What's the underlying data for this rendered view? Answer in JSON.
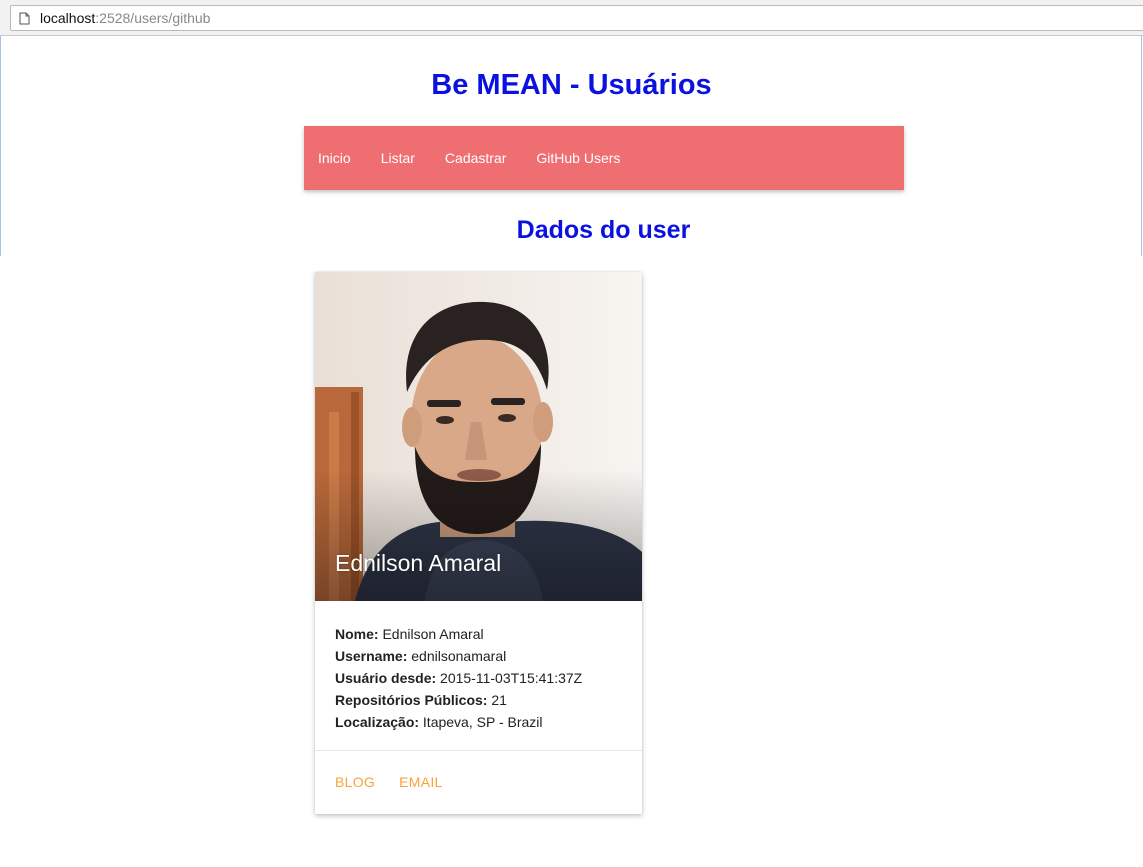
{
  "browser": {
    "url_host": "localhost",
    "url_rest": ":2528/users/github"
  },
  "header": {
    "title": "Be MEAN - Usuários"
  },
  "nav": {
    "items": [
      {
        "label": "Inicio"
      },
      {
        "label": "Listar"
      },
      {
        "label": "Cadastrar"
      },
      {
        "label": "GitHub Users"
      }
    ]
  },
  "section": {
    "title": "Dados do user"
  },
  "card": {
    "name": "Ednilson Amaral",
    "fields": [
      {
        "label": "Nome:",
        "value": "Ednilson Amaral"
      },
      {
        "label": "Username:",
        "value": "ednilsonamaral"
      },
      {
        "label": "Usuário desde:",
        "value": "2015-11-03T15:41:37Z"
      },
      {
        "label": "Repositórios Públicos:",
        "value": "21"
      },
      {
        "label": "Localização:",
        "value": "Itapeva, SP - Brazil"
      }
    ],
    "actions": {
      "blog": "BLOG",
      "email": "EMAIL"
    }
  },
  "colors": {
    "title": "#0b12e0",
    "navbar": "#ef6e72",
    "action": "#f8a33a"
  },
  "icons": {
    "url_page": "page-icon"
  }
}
